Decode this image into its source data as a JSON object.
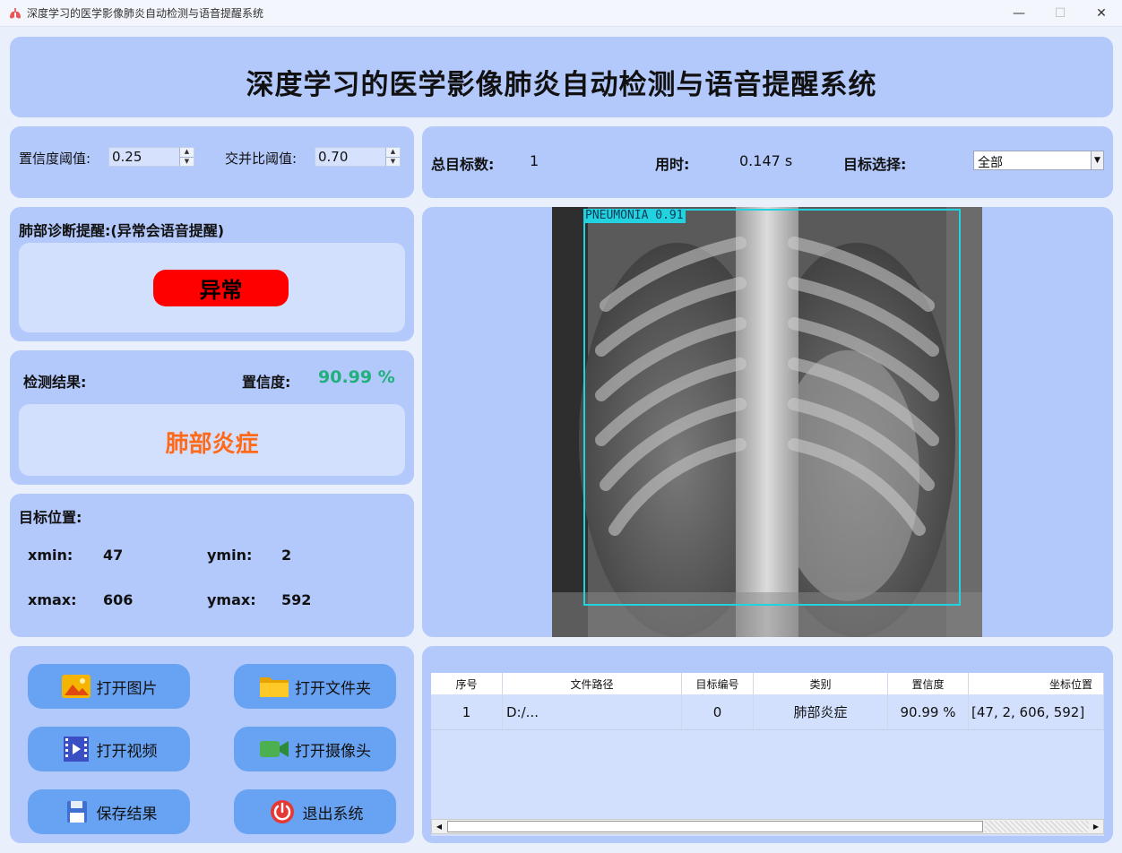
{
  "window": {
    "title": "深度学习的医学影像肺炎自动检测与语音提醒系统",
    "minimize": "—",
    "maximize": "☐",
    "close": "✕"
  },
  "header": {
    "title": "深度学习的医学影像肺炎自动检测与语音提醒系统"
  },
  "params": {
    "conf_label": "置信度阈值:",
    "conf_value": "0.25",
    "iou_label": "交并比阈值:",
    "iou_value": "0.70"
  },
  "stats": {
    "total_label": "总目标数:",
    "total_value": "1",
    "time_label": "用时:",
    "time_value": "0.147 s",
    "target_label": "目标选择:",
    "target_value": "全部"
  },
  "alert": {
    "title": "肺部诊断提醒:(异常会语音提醒)",
    "status": "异常",
    "status_color": "#ff0000"
  },
  "result": {
    "label": "检测结果:",
    "conf_label": "置信度:",
    "conf_value": "90.99 %",
    "class_text": "肺部炎症"
  },
  "position": {
    "title": "目标位置:",
    "xmin_label": "xmin:",
    "xmin": "47",
    "ymin_label": "ymin:",
    "ymin": "2",
    "xmax_label": "xmax:",
    "xmax": "606",
    "ymax_label": "ymax:",
    "ymax": "592"
  },
  "buttons": {
    "open_image": "打开图片",
    "open_folder": "打开文件夹",
    "open_video": "打开视频",
    "open_camera": "打开摄像头",
    "save": "保存结果",
    "exit": "退出系统"
  },
  "detection": {
    "label": "PNEUMONIA  0.91",
    "box_color": "#22d3df"
  },
  "table": {
    "headers": [
      "序号",
      "文件路径",
      "目标编号",
      "类别",
      "置信度",
      "坐标位置"
    ],
    "rows": [
      [
        "1",
        "D:/...",
        "0",
        "肺部炎症",
        "90.99 %",
        "[47, 2, 606, 592]"
      ]
    ]
  },
  "scrollbar": {
    "left_arrow": "◀",
    "right_arrow": "▶"
  },
  "colors": {
    "panel": "#b3c8fb",
    "inner": "#d3e0fd",
    "button": "#68a2f2",
    "confidence": "#21b07c",
    "result": "#ff6a1a"
  }
}
